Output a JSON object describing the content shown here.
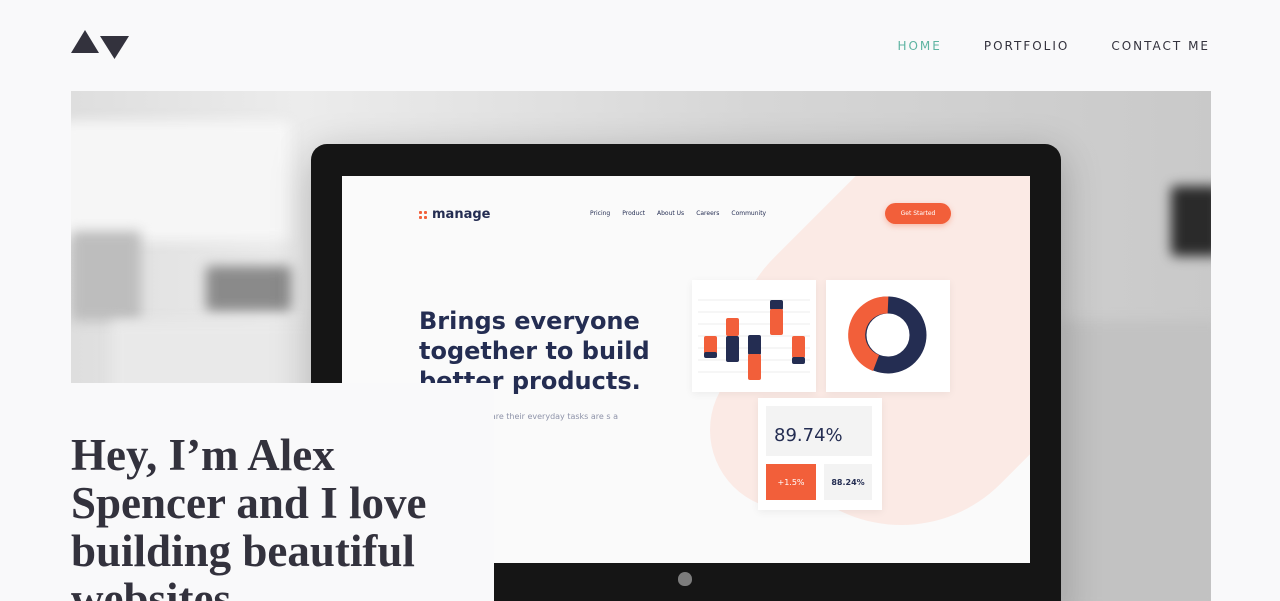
{
  "site": {
    "logo_icon": "triangles-logo-icon",
    "nav": [
      {
        "label": "HOME",
        "active": true
      },
      {
        "label": "PORTFOLIO",
        "active": false
      },
      {
        "label": "CONTACT ME",
        "active": false
      }
    ],
    "accent_color": "#5fb4a2",
    "text_color": "#33323d"
  },
  "hero": {
    "image_icon": "monitor-photo",
    "mockup": {
      "logo_text": "manage",
      "nav": [
        "Pricing",
        "Product",
        "About Us",
        "Careers",
        "Community"
      ],
      "cta": "Get Started",
      "headline": "Brings everyone together to build better products.",
      "sub": "it simple for software their everyday tasks are s a larger goal.",
      "stat_main": "89.74%",
      "stat_orange": "+1.5%",
      "stat_grey": "88.24%",
      "brand_color": "#f25f3a",
      "navy_color": "#242d52"
    }
  },
  "intro": {
    "title": "Hey, I’m Alex Spencer and I love building beautiful websites"
  }
}
